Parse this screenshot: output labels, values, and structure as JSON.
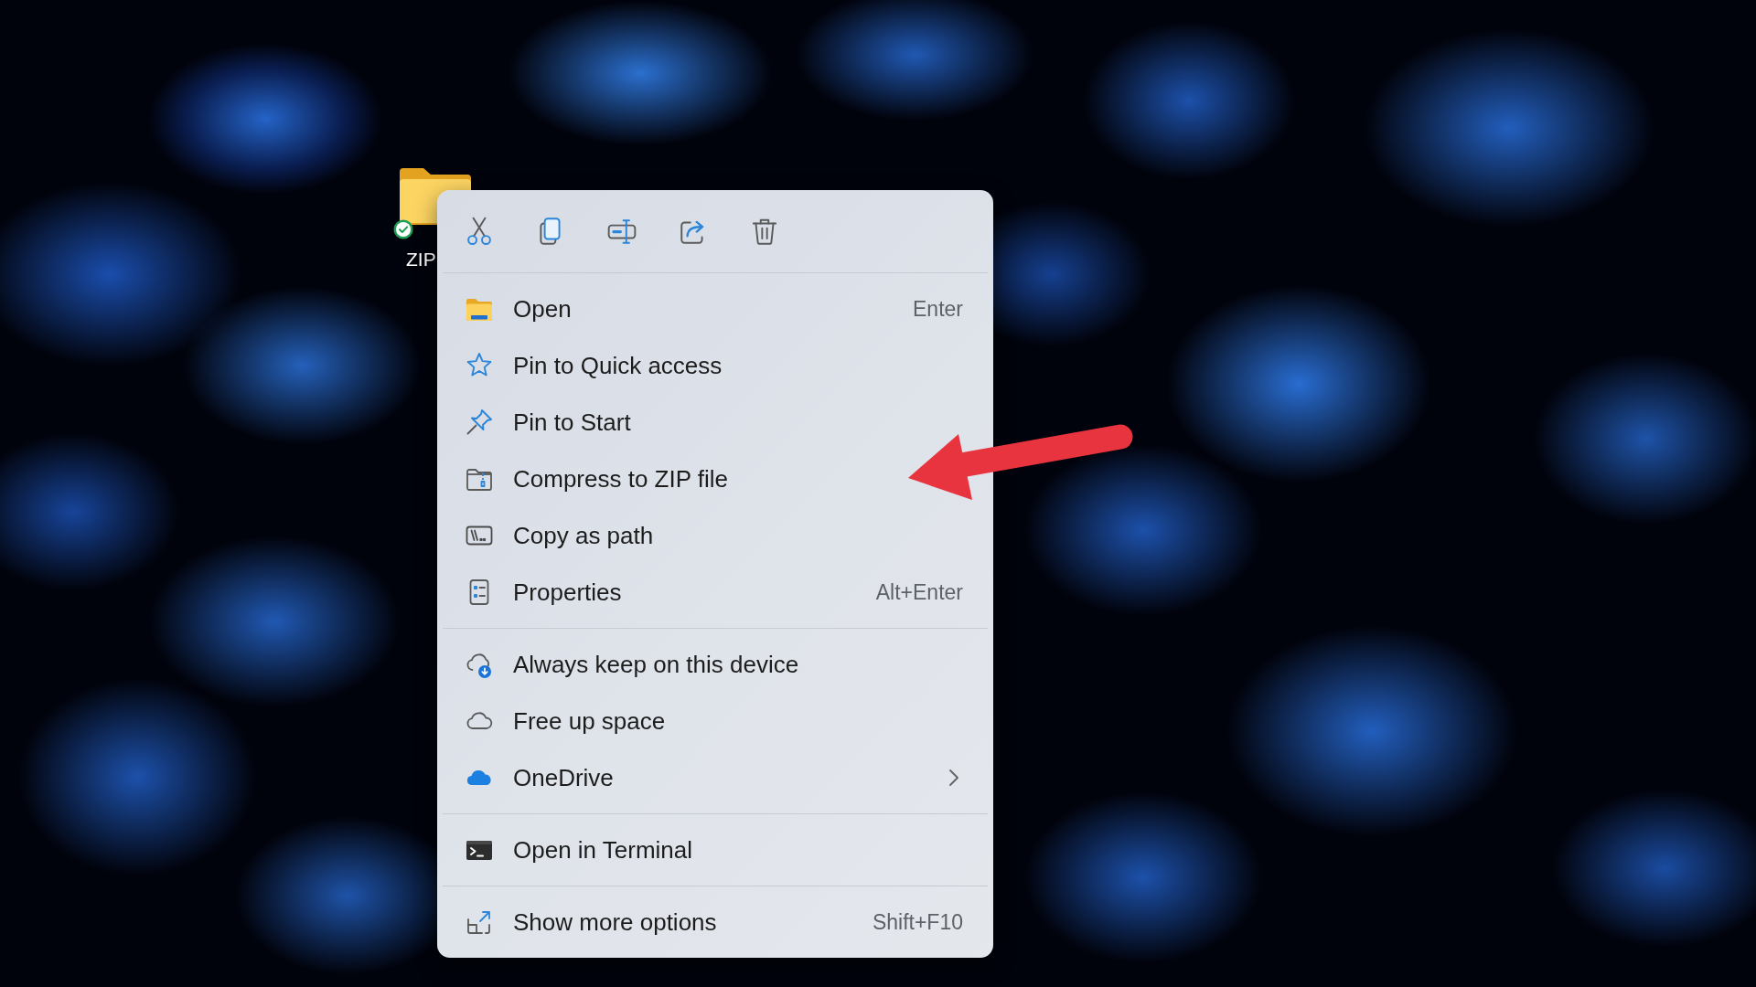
{
  "desktop": {
    "icons": [
      {
        "label": "ZIP",
        "synced": true
      }
    ]
  },
  "context_menu": {
    "groups": [
      {
        "items": [
          {
            "label": "Open",
            "shortcut": "Enter",
            "submenu": false
          },
          {
            "label": "Pin to Quick access",
            "submenu": false
          },
          {
            "label": "Pin to Start",
            "submenu": false
          },
          {
            "label": "Compress to ZIP file",
            "submenu": false
          },
          {
            "label": "Copy as path",
            "submenu": false
          },
          {
            "label": "Properties",
            "shortcut": "Alt+Enter",
            "submenu": false
          }
        ]
      },
      {
        "items": [
          {
            "label": "Always keep on this device",
            "submenu": false
          },
          {
            "label": "Free up space",
            "submenu": false
          },
          {
            "label": "OneDrive",
            "submenu": true
          }
        ]
      },
      {
        "items": [
          {
            "label": "Open in Terminal",
            "submenu": false
          }
        ]
      },
      {
        "items": [
          {
            "label": "Show more options",
            "shortcut": "Shift+F10",
            "submenu": false
          }
        ]
      }
    ]
  }
}
